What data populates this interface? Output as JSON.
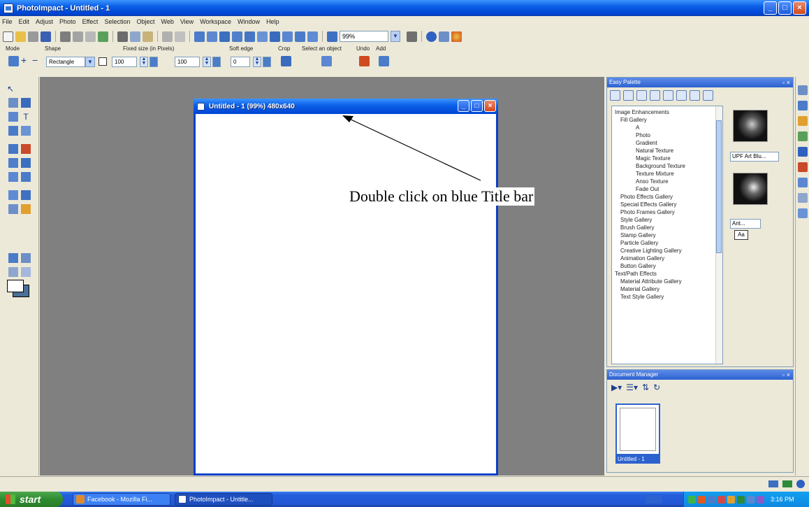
{
  "app": {
    "title": "PhotoImpact - Untitled - 1",
    "window_buttons": [
      "_",
      "□",
      "×"
    ]
  },
  "menu": [
    "File",
    "Edit",
    "Adjust",
    "Photo",
    "Effect",
    "Selection",
    "Object",
    "Web",
    "View",
    "Workspace",
    "Window",
    "Help"
  ],
  "toolbar": {
    "zoom_value": "99%",
    "icons": [
      "new-icon",
      "open-icon",
      "scan-icon",
      "save-icon",
      "print-icon",
      "print-preview-icon",
      "preview-icon",
      "capture-icon",
      "cut-icon",
      "copy-icon",
      "paste-icon",
      "undo-icon",
      "redo-icon",
      "adjust-icon",
      "enhance-icon",
      "focus-icon",
      "effects-icon",
      "crop-icon",
      "resize-icon",
      "text-icon",
      "frame-icon",
      "shadow-icon",
      "web-icon",
      "brush-icon"
    ]
  },
  "attributes": {
    "labels": [
      "Mode",
      "Shape",
      "Fixed size (in Pixels)",
      "Soft edge",
      "Crop",
      "Select an object",
      "Undo",
      "Add"
    ],
    "shape_value": "Rectangle",
    "width_value": "100",
    "height_value": "100",
    "soft_edge_value": "0"
  },
  "document": {
    "title": "Untitled - 1 (99%) 480x640"
  },
  "annotation": {
    "text": "Double click on blue Title bar"
  },
  "easy_palette": {
    "title": "Easy Palette",
    "tree": [
      "Image Enhancements",
      "Fill Gallery",
      "A",
      "Photo",
      "Gradient",
      "Natural Texture",
      "Magic Texture",
      "Background Texture",
      "Texture Mixture",
      "Anso Texture",
      "Fade Out",
      "Photo Effects Gallery",
      "Special Effects Gallery",
      "Photo Frames Gallery",
      "Style Gallery",
      "Brush Gallery",
      "Stamp Gallery",
      "Particle Gallery",
      "Creative Lighting Gallery",
      "Animation Gallery",
      "Button Gallery",
      "Text/Path Effects",
      "Material Attribute Gallery",
      "Material Gallery",
      "Text Style Gallery"
    ],
    "thumbs": [
      "UPF Art Blu...",
      "Ant..."
    ],
    "tag": "Aa"
  },
  "document_manager": {
    "title": "Document Manager",
    "item_label": "Untitled - 1"
  },
  "taskbar": {
    "start_label": "start",
    "items": [
      "Facebook - Mozilla Fi...",
      "PhotoImpact - Untitle..."
    ],
    "clock": "3:16 PM"
  },
  "colors": {
    "title_blue": "#0a5fe6",
    "workspace_gray": "#808080",
    "panel_beige": "#ece9d8"
  }
}
